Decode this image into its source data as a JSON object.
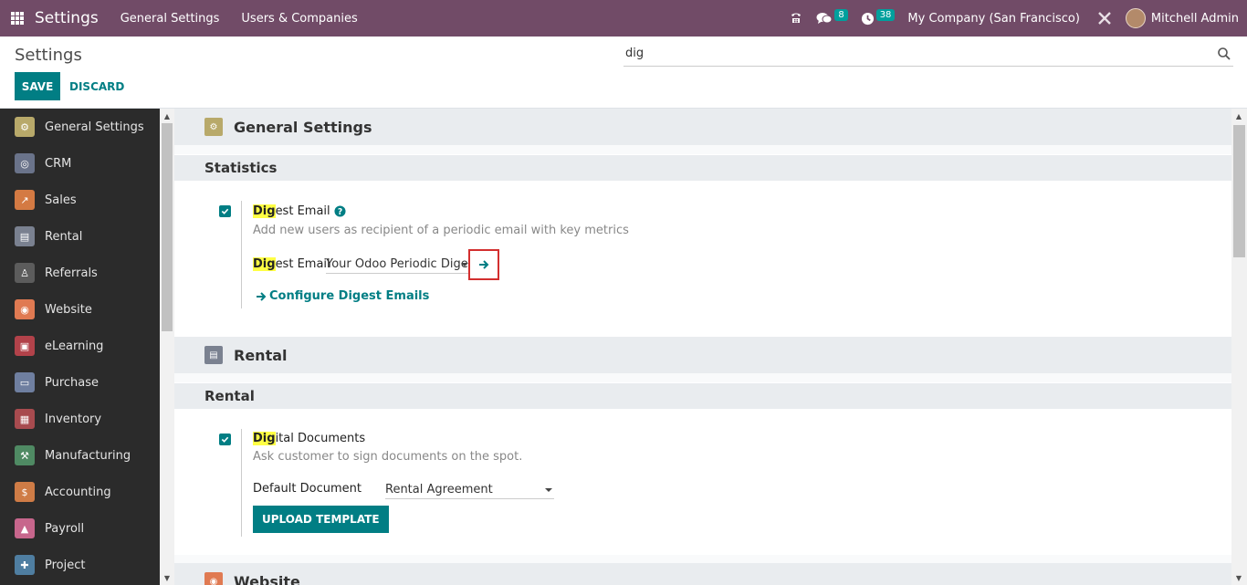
{
  "navbar": {
    "brand": "Settings",
    "menus": [
      "General Settings",
      "Users & Companies"
    ],
    "messages_count": "8",
    "activities_count": "38",
    "company": "My Company (San Francisco)",
    "user": "Mitchell Admin"
  },
  "control": {
    "title": "Settings",
    "save": "SAVE",
    "discard": "DISCARD",
    "search_value": "dig"
  },
  "sidebar": {
    "items": [
      {
        "label": "General Settings",
        "color": "#b8a96a"
      },
      {
        "label": "CRM",
        "color": "#6a738a"
      },
      {
        "label": "Sales",
        "color": "#d47a43"
      },
      {
        "label": "Rental",
        "color": "#7a8190"
      },
      {
        "label": "Referrals",
        "color": "#5c5c5c"
      },
      {
        "label": "Website",
        "color": "#e07a52"
      },
      {
        "label": "eLearning",
        "color": "#b2424a"
      },
      {
        "label": "Purchase",
        "color": "#6f7fa0"
      },
      {
        "label": "Inventory",
        "color": "#a84b4f"
      },
      {
        "label": "Manufacturing",
        "color": "#4f8a63"
      },
      {
        "label": "Accounting",
        "color": "#cf7c46"
      },
      {
        "label": "Payroll",
        "color": "#c7668c"
      },
      {
        "label": "Project",
        "color": "#4f7ea1"
      }
    ]
  },
  "main": {
    "general_settings": {
      "title": "General Settings",
      "section": "Statistics",
      "setting": {
        "title_hl": "Dig",
        "title_rest": "est Email",
        "description": "Add new users as recipient of a periodic email with key metrics",
        "field_hl": "Dig",
        "field_rest": "est Email",
        "field_value": "Your Odoo Periodic Diges",
        "link": "Configure Digest Emails"
      }
    },
    "rental": {
      "title": "Rental",
      "section": "Rental",
      "setting": {
        "title_hl": "Dig",
        "title_rest": "ital Documents",
        "description": "Ask customer to sign documents on the spot.",
        "field_label": "Default Document",
        "field_value": "Rental Agreement",
        "button": "UPLOAD TEMPLATE"
      }
    },
    "website": {
      "title": "Website"
    }
  },
  "colors": {
    "navbar": "#714b67",
    "primary": "#017e84",
    "highlight": "#ffff44"
  }
}
